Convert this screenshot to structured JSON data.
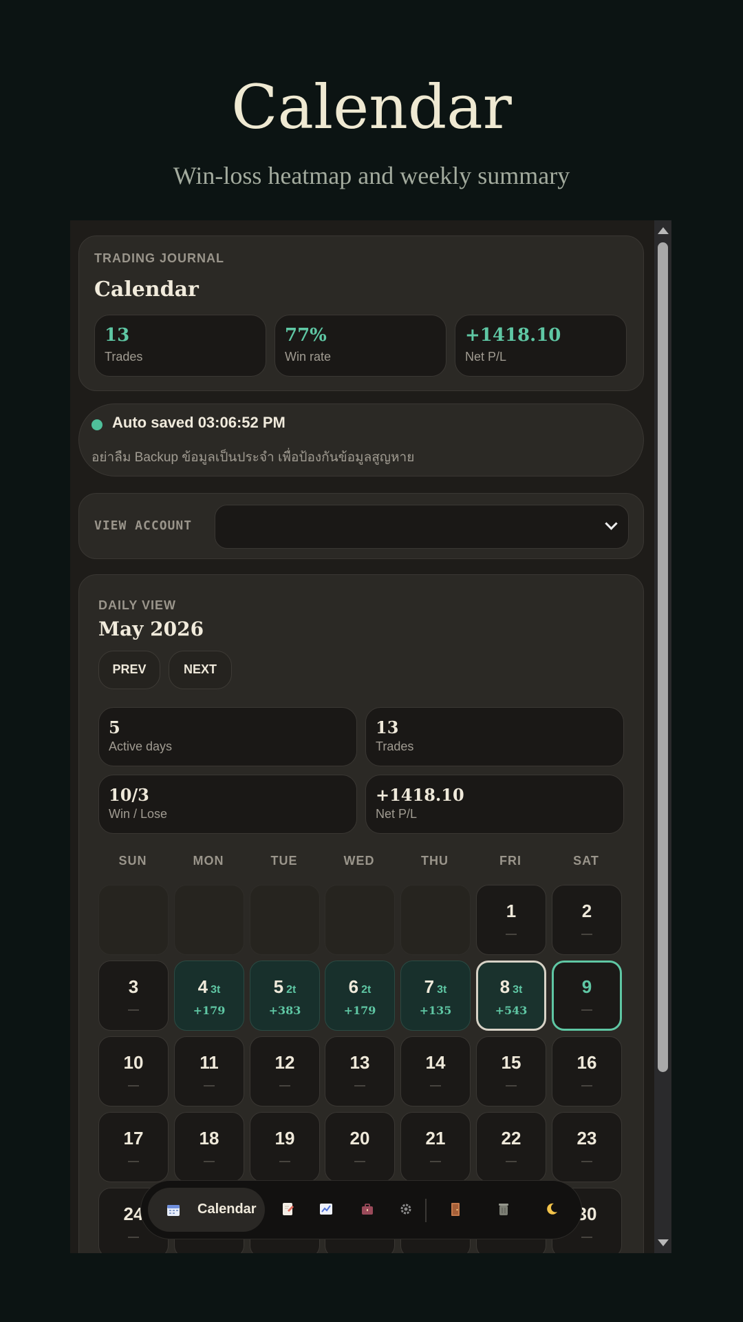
{
  "header": {
    "title": "Calendar",
    "subtitle": "Win-loss heatmap and weekly summary"
  },
  "journal": {
    "eyebrow": "TRADING JOURNAL",
    "title": "Calendar",
    "stats": [
      {
        "value": "13",
        "label": "Trades"
      },
      {
        "value": "77%",
        "label": "Win rate"
      },
      {
        "value": "+1418.10",
        "label": "Net P/L"
      }
    ]
  },
  "autosave": {
    "status": "Auto saved 03:06:52 PM",
    "reminder": "อย่าลืม Backup ข้อมูลเป็นประจำ เพื่อป้องกันข้อมูลสูญหาย"
  },
  "account": {
    "label": "VIEW ACCOUNT",
    "selected": ""
  },
  "calendar": {
    "eyebrow": "DAILY VIEW",
    "month": "May 2026",
    "prev": "PREV",
    "next": "NEXT",
    "summary": [
      {
        "value": "5",
        "label": "Active days"
      },
      {
        "value": "13",
        "label": "Trades"
      },
      {
        "value": "10/3",
        "label": "Win / Lose"
      },
      {
        "value": "+1418.10",
        "label": "Net P/L"
      }
    ],
    "weekdays": [
      "SUN",
      "MON",
      "TUE",
      "WED",
      "THU",
      "FRI",
      "SAT"
    ],
    "days": [
      {
        "day": "1",
        "trades": "",
        "pl": "—",
        "state": "normal"
      },
      {
        "day": "2",
        "trades": "",
        "pl": "—",
        "state": "normal"
      },
      {
        "day": "3",
        "trades": "",
        "pl": "—",
        "state": "normal"
      },
      {
        "day": "4",
        "trades": "3t",
        "pl": "+179",
        "state": "win"
      },
      {
        "day": "5",
        "trades": "2t",
        "pl": "+383",
        "state": "win"
      },
      {
        "day": "6",
        "trades": "2t",
        "pl": "+179",
        "state": "win"
      },
      {
        "day": "7",
        "trades": "3t",
        "pl": "+135",
        "state": "win"
      },
      {
        "day": "8",
        "trades": "3t",
        "pl": "+543",
        "state": "selected"
      },
      {
        "day": "9",
        "trades": "",
        "pl": "—",
        "state": "today"
      },
      {
        "day": "10",
        "trades": "",
        "pl": "—",
        "state": "normal"
      },
      {
        "day": "11",
        "trades": "",
        "pl": "—",
        "state": "normal"
      },
      {
        "day": "12",
        "trades": "",
        "pl": "—",
        "state": "normal"
      },
      {
        "day": "13",
        "trades": "",
        "pl": "—",
        "state": "normal"
      },
      {
        "day": "14",
        "trades": "",
        "pl": "—",
        "state": "normal"
      },
      {
        "day": "15",
        "trades": "",
        "pl": "—",
        "state": "normal"
      },
      {
        "day": "16",
        "trades": "",
        "pl": "—",
        "state": "normal"
      },
      {
        "day": "17",
        "trades": "",
        "pl": "—",
        "state": "normal"
      },
      {
        "day": "18",
        "trades": "",
        "pl": "—",
        "state": "normal"
      },
      {
        "day": "19",
        "trades": "",
        "pl": "—",
        "state": "normal"
      },
      {
        "day": "20",
        "trades": "",
        "pl": "—",
        "state": "normal"
      },
      {
        "day": "21",
        "trades": "",
        "pl": "—",
        "state": "normal"
      },
      {
        "day": "22",
        "trades": "",
        "pl": "—",
        "state": "normal"
      },
      {
        "day": "23",
        "trades": "",
        "pl": "—",
        "state": "normal"
      },
      {
        "day": "24",
        "trades": "",
        "pl": "—",
        "state": "normal"
      },
      {
        "day": "30",
        "trades": "",
        "pl": "—",
        "state": "normal"
      }
    ]
  },
  "dock": {
    "active_label": "Calendar",
    "icons": [
      "calendar-icon",
      "notes-icon",
      "chart-icon",
      "briefcase-icon",
      "gear-icon",
      "door-icon",
      "trash-icon",
      "moon-icon"
    ]
  },
  "colors": {
    "background": "#0c1413",
    "accent": "#5fc7a4",
    "card": "#2b2925"
  }
}
